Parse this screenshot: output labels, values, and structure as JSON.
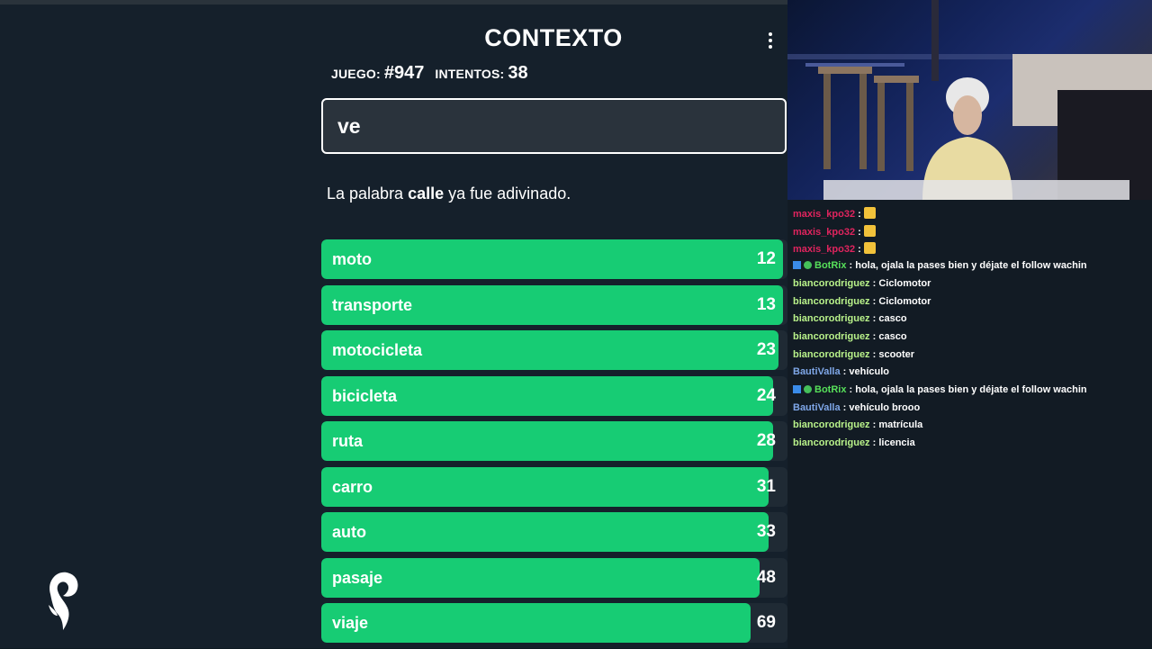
{
  "game": {
    "title": "CONTEXTO",
    "game_label": "JUEGO:",
    "game_number": "#947",
    "attempts_label": "INTENTOS:",
    "attempts": "38",
    "input_value": "ve",
    "message": {
      "before": "La palabra ",
      "word": "calle",
      "after": " ya fue adivinado."
    },
    "accent_color": "#17cc74",
    "guesses": [
      {
        "word": "moto",
        "rank": "12",
        "fill_pct": 99
      },
      {
        "word": "transporte",
        "rank": "13",
        "fill_pct": 99
      },
      {
        "word": "motocicleta",
        "rank": "23",
        "fill_pct": 98
      },
      {
        "word": "bicicleta",
        "rank": "24",
        "fill_pct": 97
      },
      {
        "word": "ruta",
        "rank": "28",
        "fill_pct": 97
      },
      {
        "word": "carro",
        "rank": "31",
        "fill_pct": 96
      },
      {
        "word": "auto",
        "rank": "33",
        "fill_pct": 96
      },
      {
        "word": "pasaje",
        "rank": "48",
        "fill_pct": 94
      },
      {
        "word": "viaje",
        "rank": "69",
        "fill_pct": 92
      }
    ]
  },
  "chat": {
    "messages": [
      {
        "user": "maxis_kpo32",
        "user_color": "#e0245e",
        "text": "",
        "emote": true
      },
      {
        "user": "maxis_kpo32",
        "user_color": "#e0245e",
        "text": "",
        "emote": true
      },
      {
        "user": "maxis_kpo32",
        "user_color": "#e0245e",
        "text": "",
        "emote": true
      },
      {
        "user": "BotRix",
        "user_color": "#57e05a",
        "text": "hola, ojala la pases bien y déjate el follow wachin",
        "badges": true
      },
      {
        "user": "biancorodriguez",
        "user_color": "#b9f28a",
        "text": "Ciclomotor"
      },
      {
        "user": "biancorodriguez",
        "user_color": "#b9f28a",
        "text": "Ciclomotor"
      },
      {
        "user": "biancorodriguez",
        "user_color": "#b9f28a",
        "text": "casco"
      },
      {
        "user": "biancorodriguez",
        "user_color": "#b9f28a",
        "text": "casco"
      },
      {
        "user": "biancorodriguez",
        "user_color": "#b9f28a",
        "text": "scooter"
      },
      {
        "user": "BautiValla",
        "user_color": "#7fa7e8",
        "text": "vehículo"
      },
      {
        "user": "BotRix",
        "user_color": "#57e05a",
        "text": "hola, ojala la pases bien y déjate el follow wachin",
        "badges": true
      },
      {
        "user": "BautiValla",
        "user_color": "#7fa7e8",
        "text": "vehículo brooo"
      },
      {
        "user": "biancorodriguez",
        "user_color": "#b9f28a",
        "text": "matrícula"
      },
      {
        "user": "biancorodriguez",
        "user_color": "#b9f28a",
        "text": "licencia"
      }
    ]
  }
}
